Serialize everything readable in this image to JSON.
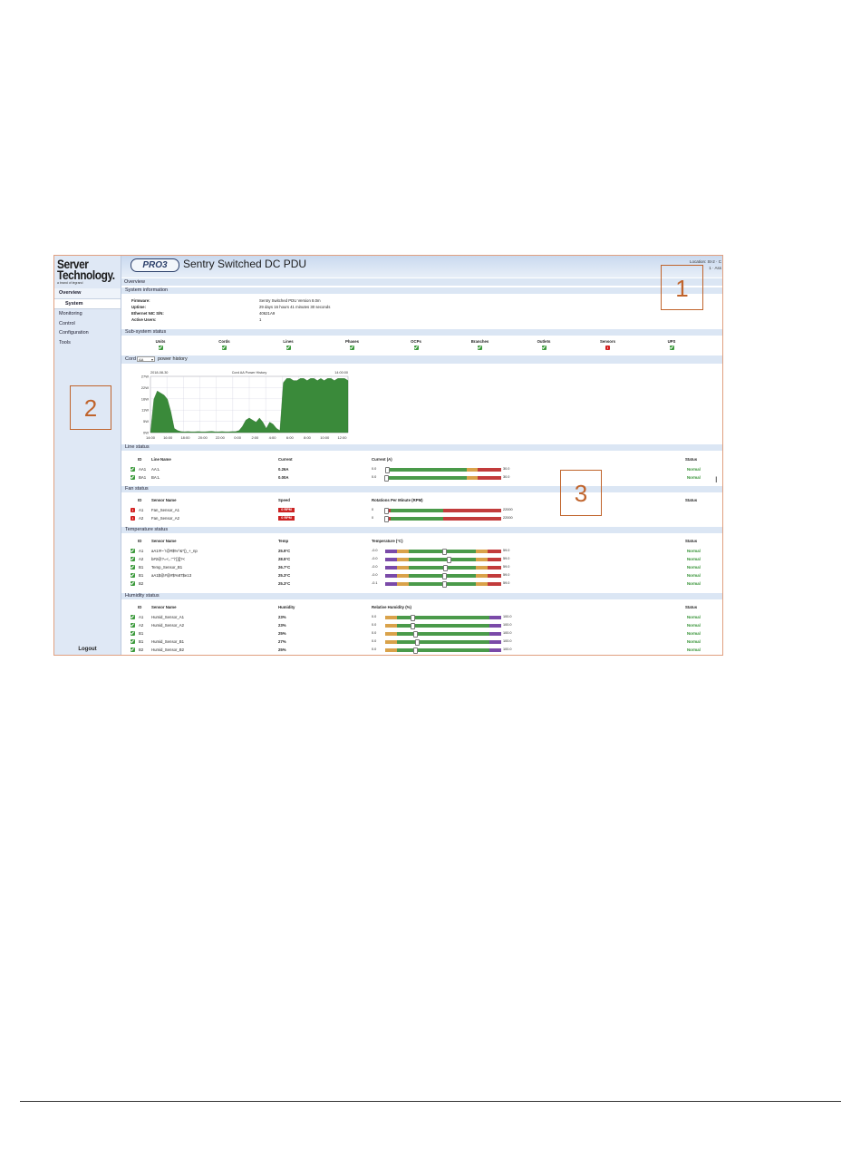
{
  "logo": {
    "line1": "Server",
    "line2": "Technology.",
    "line3": "a brand of legrand"
  },
  "nav": {
    "overview": "Overview",
    "system": "System",
    "monitoring": "Monitoring",
    "control": "Control",
    "configuration": "Configuration",
    "tools": "Tools",
    "logout": "Logout"
  },
  "header": {
    "badge": "PRO3",
    "title": "Sentry Switched DC PDU",
    "location_label": "Location:",
    "location_value": "St-2 · C",
    "sub_value": "1 · Ass"
  },
  "overview_title": "Overview",
  "sysinfo": {
    "title": "System information",
    "rows": [
      {
        "label": "Firmware:",
        "value": "Sentry Switched PDU Version 8.0m"
      },
      {
        "label": "Uptime:",
        "value": "29 days 16 hours 41 minutes 30 seconds"
      },
      {
        "label": "Ethernet NIC S/N:",
        "value": "40621A9"
      },
      {
        "label": "Active Users:",
        "value": "1"
      }
    ]
  },
  "subsystem": {
    "title": "Sub-system status",
    "items": [
      {
        "label": "Units",
        "ok": true
      },
      {
        "label": "Cords",
        "ok": true
      },
      {
        "label": "Lines",
        "ok": true
      },
      {
        "label": "Phases",
        "ok": true
      },
      {
        "label": "OCPs",
        "ok": true
      },
      {
        "label": "Branches",
        "ok": true
      },
      {
        "label": "Outlets",
        "ok": true
      },
      {
        "label": "Sensors",
        "ok": false
      },
      {
        "label": "UPS",
        "ok": true
      }
    ]
  },
  "cord": {
    "label": "Cord",
    "select_value": "AA",
    "suffix": "power history"
  },
  "chart_data": {
    "type": "area",
    "title": "Cord AA Power History",
    "date_left": "2018-08-30",
    "date_right": "14:00:00",
    "ylabel": "",
    "y_ticks": [
      "27W",
      "22W",
      "16W",
      "11W",
      "5W",
      "0W"
    ],
    "ylim": [
      0,
      27
    ],
    "x_ticks": [
      "14:00",
      "16:00",
      "18:00",
      "20:00",
      "22:00",
      "0:00",
      "2:00",
      "4:00",
      "6:00",
      "8:00",
      "10:00",
      "12:00"
    ],
    "series": [
      {
        "values": [
          0,
          16,
          20,
          19,
          18,
          16,
          10,
          2,
          1,
          0.5,
          0.4,
          0.5,
          0.4,
          0.4,
          0.5,
          0.4,
          0.4,
          0.5,
          0.6,
          0.4,
          0.4,
          0.5,
          0.4,
          0.4,
          0.5,
          0.5,
          1,
          3,
          6,
          7,
          6,
          5,
          7,
          5,
          2,
          5,
          4,
          2,
          1,
          24,
          26,
          26,
          25,
          25,
          26,
          26,
          25,
          26,
          26,
          25,
          26,
          25,
          26,
          26,
          25,
          26,
          26,
          26,
          25
        ]
      }
    ],
    "color": "#3a8a3a"
  },
  "line_status": {
    "title": "Line status",
    "headers": {
      "id": "ID",
      "name": "Line Name",
      "current": "Current",
      "range": "Current (A)",
      "status": "Status"
    },
    "rows": [
      {
        "id": "AA1",
        "name": "AA:L",
        "current": "0.26A",
        "min": "0.0",
        "max": "30.0",
        "value_fraction": 0.01,
        "status": "Normal"
      },
      {
        "id": "BA1",
        "name": "BA:L",
        "current": "0.00A",
        "min": "0.0",
        "max": "30.0",
        "value_fraction": 0.0,
        "status": "Normal"
      }
    ]
  },
  "fan_status": {
    "title": "Fan status",
    "headers": {
      "id": "ID",
      "name": "Sensor Name",
      "speed": "Speed",
      "range": "Rotations Per Minute (RPM)",
      "status": "Status"
    },
    "rows": [
      {
        "id": "A1",
        "name": "Fan_Sensor_A1",
        "speed": "0 RPM",
        "min": "0",
        "max": "22000",
        "value_fraction": 0.0
      },
      {
        "id": "A2",
        "name": "Fan_Sensor_A2",
        "speed": "0 RPM",
        "min": "0",
        "max": "22000",
        "value_fraction": 0.0
      }
    ]
  },
  "temp_status": {
    "title": "Temperature status",
    "headers": {
      "id": "ID",
      "name": "Sensor Name",
      "temp": "Temp",
      "range": "Temperature (°C)",
      "status": "Status"
    },
    "rows": [
      {
        "id": "A1",
        "name": "aA1!#~`!@#$%^&*()_+_np",
        "temp": "25.9°C",
        "min": "-0.0",
        "max": "59.0",
        "value_fraction": 0.5,
        "status": "Normal"
      },
      {
        "id": "A2",
        "name": "b#2@?=<,.:\"'\\'{}[]?<",
        "temp": "28.5°C",
        "min": "-0.0",
        "max": "59.0",
        "value_fraction": 0.54,
        "status": "Normal"
      },
      {
        "id": "B1",
        "name": "Temp_Sensor_B1",
        "temp": "26.7°C",
        "min": "-0.0",
        "max": "59.0",
        "value_fraction": 0.51,
        "status": "Normal"
      },
      {
        "id": "B1",
        "name": "aA1$@#@#$%87$e13",
        "temp": "25.3°C",
        "min": "-0.0",
        "max": "59.0",
        "value_fraction": 0.5,
        "status": "Normal"
      },
      {
        "id": "B2",
        "name": "",
        "temp": "25.3°C",
        "min": "-0.1",
        "max": "59.0",
        "value_fraction": 0.5,
        "status": "Normal"
      }
    ]
  },
  "humid_status": {
    "title": "Humidity status",
    "headers": {
      "id": "ID",
      "name": "Sensor Name",
      "humidity": "Humidity",
      "range": "Relative Humidity (%)",
      "status": "Status"
    },
    "rows": [
      {
        "id": "A1",
        "name": "Humid_Sensor_A1",
        "humidity": "23%",
        "min": "0.0",
        "max": "100.0",
        "value_fraction": 0.23,
        "status": "Normal"
      },
      {
        "id": "A2",
        "name": "Humid_Sensor_A2",
        "humidity": "23%",
        "min": "0.0",
        "max": "100.0",
        "value_fraction": 0.23,
        "status": "Normal"
      },
      {
        "id": "B1",
        "name": "",
        "humidity": "25%",
        "min": "0.0",
        "max": "100.0",
        "value_fraction": 0.25,
        "status": "Normal"
      },
      {
        "id": "B1",
        "name": "Humid_Sensor_B1",
        "humidity": "27%",
        "min": "0.0",
        "max": "100.0",
        "value_fraction": 0.27,
        "status": "Normal"
      },
      {
        "id": "B2",
        "name": "Humid_Sensor_B2",
        "humidity": "25%",
        "min": "0.0",
        "max": "100.0",
        "value_fraction": 0.25,
        "status": "Normal"
      }
    ]
  },
  "callouts": [
    "1",
    "2",
    "3"
  ]
}
